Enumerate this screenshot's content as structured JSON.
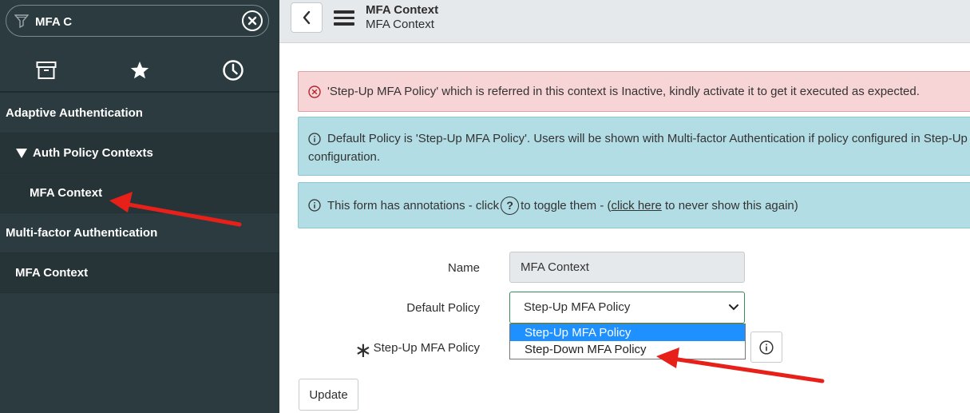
{
  "sidebar": {
    "filter": {
      "value": "MFA C",
      "icon": "filter-icon",
      "clear_icon": "clear-icon"
    },
    "tabs": [
      {
        "name": "archive",
        "icon": "archive-icon"
      },
      {
        "name": "favorites",
        "icon": "star-icon"
      },
      {
        "name": "history",
        "icon": "clock-icon"
      }
    ],
    "items": [
      {
        "label": "Adaptive Authentication"
      },
      {
        "label": "Auth Policy Contexts"
      },
      {
        "label": "MFA Context"
      },
      {
        "label": "Multi-factor Authentication"
      },
      {
        "label": "MFA Context"
      }
    ]
  },
  "header": {
    "title": "MFA Context",
    "subtitle": "MFA Context"
  },
  "alerts": {
    "error": "'Step-Up MFA Policy' which is referred in this context is Inactive, kindly activate it to get it executed as expected.",
    "info1_line1": "Default Policy is 'Step-Up MFA Policy'. Users will be shown with Multi-factor Authentication if policy configured in Step-Up",
    "info1_line2": "configuration.",
    "info2_prefix": "This form has annotations - click",
    "info2_mid": "to toggle them - (",
    "info2_link": "click here",
    "info2_suffix": " to never show this again)",
    "q_glyph": "?"
  },
  "form": {
    "name_label": "Name",
    "name_value": "MFA Context",
    "default_policy_label": "Default Policy",
    "default_policy_value": "Step-Up MFA Policy",
    "options": [
      "Step-Up MFA Policy",
      "Step-Down MFA Policy"
    ],
    "stepup_label": "Step-Up MFA Policy",
    "required_mark": "∗",
    "update_label": "Update"
  },
  "colors": {
    "sidebar_bg": "#2b3b3f",
    "error_bg": "#f7d4d6",
    "info_bg": "#b2dde5",
    "selected_option": "#1e90ff",
    "annotation_arrow": "#e8201a"
  }
}
